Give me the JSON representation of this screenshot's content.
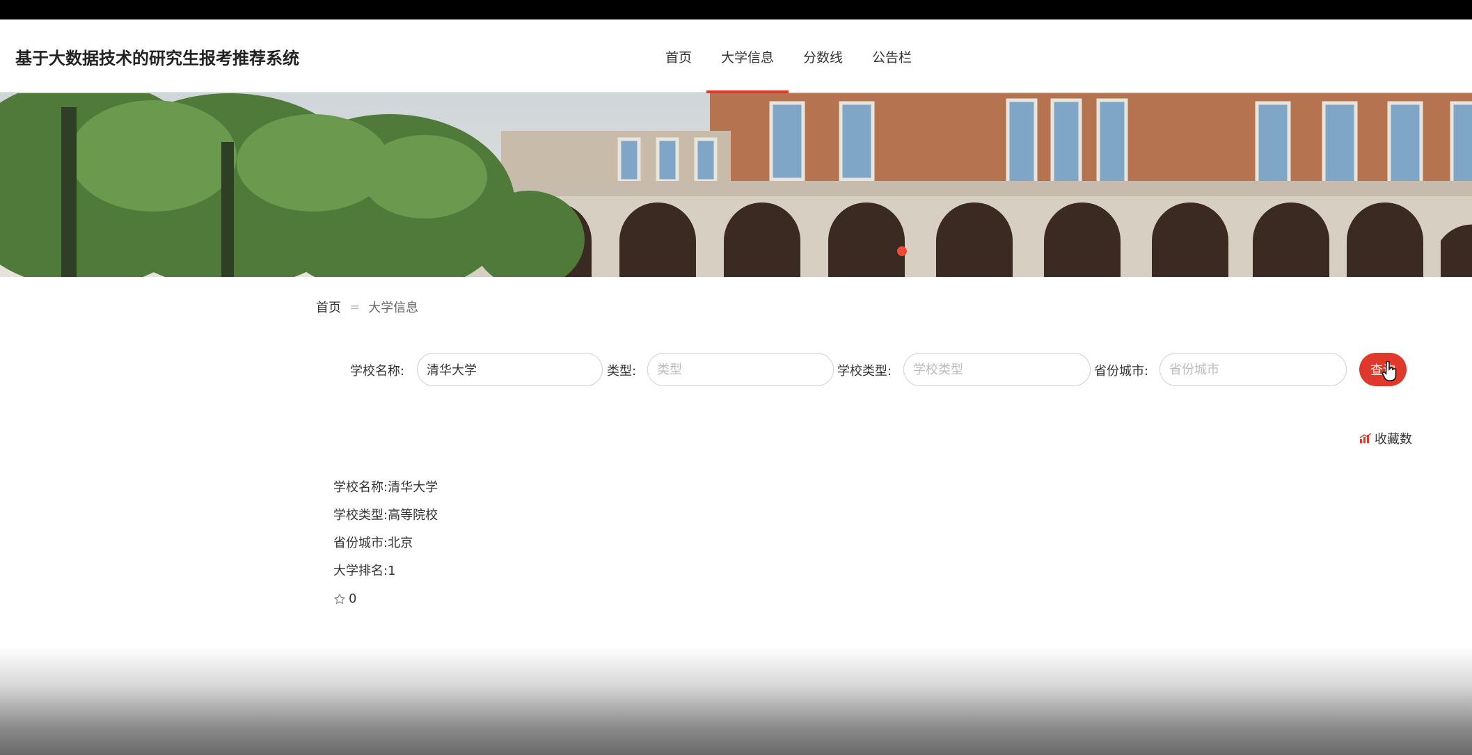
{
  "header": {
    "site_title": "基于大数据技术的研究生报考推荐系统",
    "nav": [
      {
        "label": "首页",
        "active": false
      },
      {
        "label": "大学信息",
        "active": true
      },
      {
        "label": "分数线",
        "active": false
      },
      {
        "label": "公告栏",
        "active": false
      }
    ],
    "accent_color": "#e0382a"
  },
  "breadcrumb": {
    "home": "首页",
    "separator": "=",
    "current": "大学信息"
  },
  "search": {
    "school_name": {
      "label": "学校名称:",
      "value": "清华大学",
      "placeholder": "学校名称"
    },
    "type": {
      "label": "类型:",
      "value": "",
      "placeholder": "类型"
    },
    "school_type": {
      "label": "学校类型:",
      "value": "",
      "placeholder": "学校类型"
    },
    "province_city": {
      "label": "省份城市:",
      "value": "",
      "placeholder": "省份城市"
    },
    "button_label": "查询"
  },
  "sort": {
    "label": "收藏数",
    "icon": "bar-chart-icon"
  },
  "results": [
    {
      "school_name": "学校名称:清华大学",
      "school_type": "学校类型:高等院校",
      "province_city": "省份城市:北京",
      "ranking": "大学排名:1",
      "favorites": "0",
      "favorite_icon": "star-outline-icon"
    }
  ]
}
